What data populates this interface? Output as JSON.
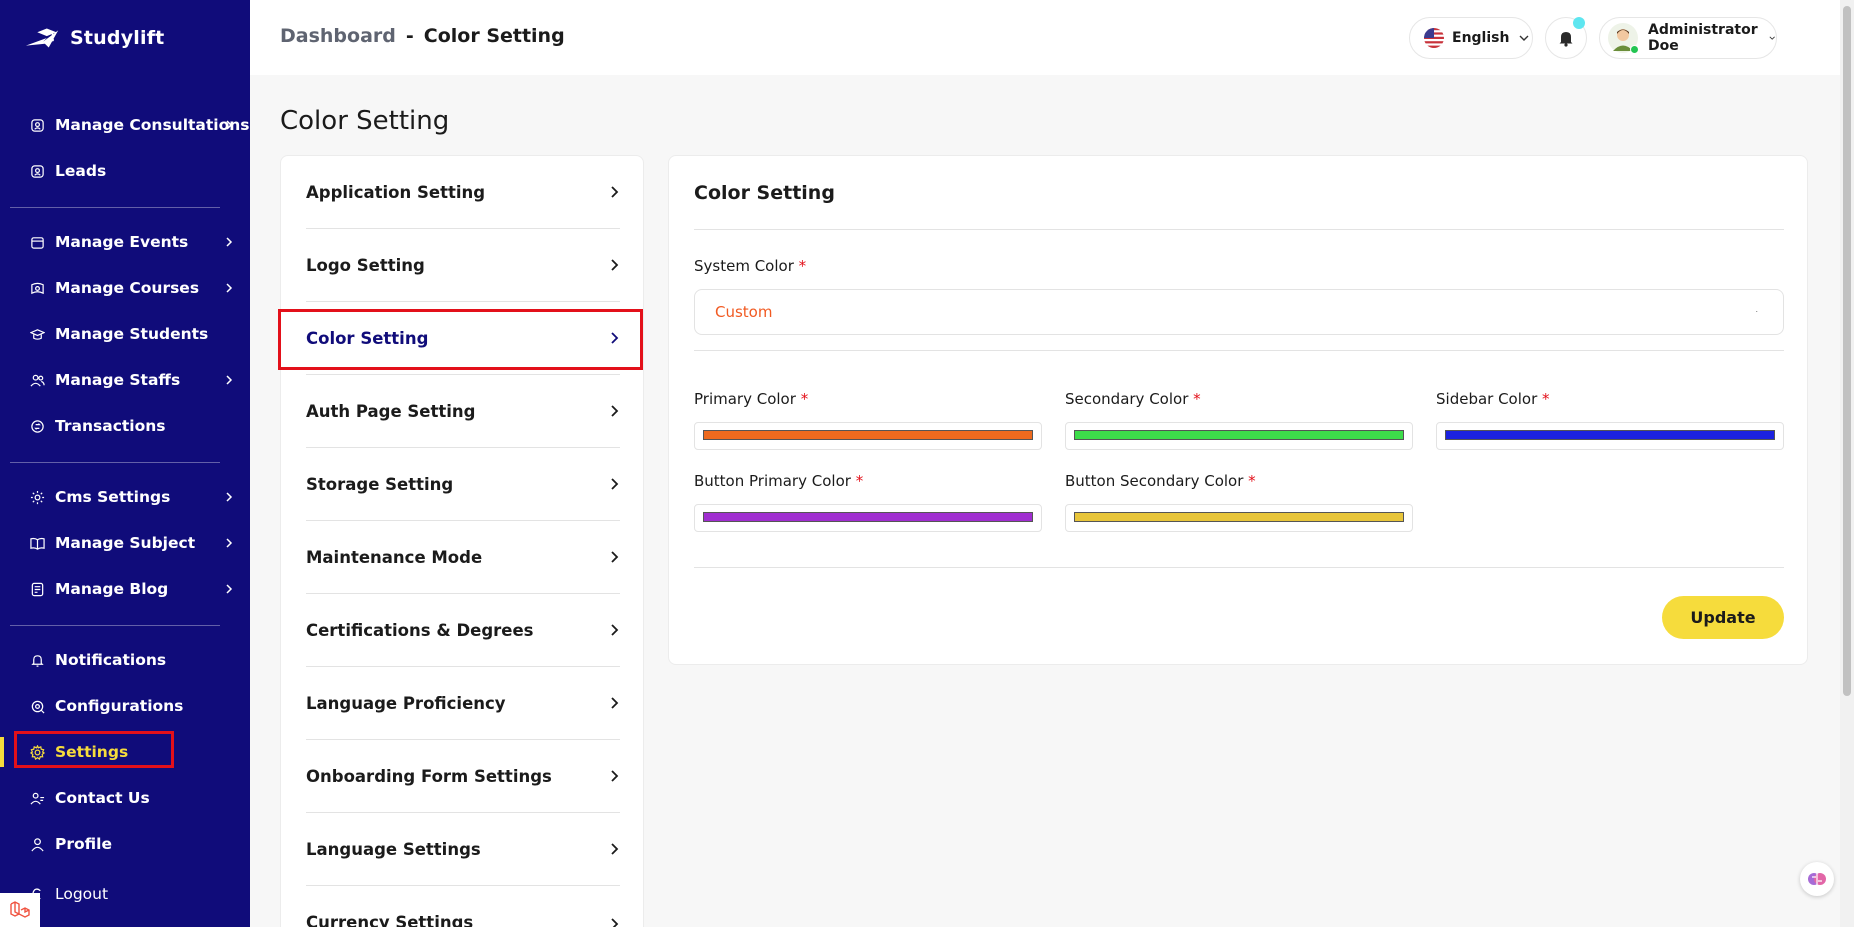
{
  "app": {
    "name": "Studylift"
  },
  "sidebar": {
    "items": [
      {
        "label": "Manage Consultations",
        "icon": "consultation-icon",
        "has_children": true
      },
      {
        "label": "Leads",
        "icon": "leads-icon",
        "has_children": false
      },
      {
        "label": "Manage Events",
        "icon": "calendar-icon",
        "has_children": true
      },
      {
        "label": "Manage Courses",
        "icon": "courses-icon",
        "has_children": true
      },
      {
        "label": "Manage Students",
        "icon": "students-icon",
        "has_children": false
      },
      {
        "label": "Manage Staffs",
        "icon": "staff-icon",
        "has_children": true
      },
      {
        "label": "Transactions",
        "icon": "transactions-icon",
        "has_children": false
      },
      {
        "label": "Cms Settings",
        "icon": "cms-icon",
        "has_children": true
      },
      {
        "label": "Manage Subject",
        "icon": "book-icon",
        "has_children": true
      },
      {
        "label": "Manage Blog",
        "icon": "blog-icon",
        "has_children": true
      },
      {
        "label": "Notifications",
        "icon": "bell-icon",
        "has_children": false
      },
      {
        "label": "Configurations",
        "icon": "configuration-icon",
        "has_children": false
      },
      {
        "label": "Settings",
        "icon": "gear-icon",
        "has_children": false,
        "active": true
      },
      {
        "label": "Contact Us",
        "icon": "contact-icon",
        "has_children": false
      },
      {
        "label": "Profile",
        "icon": "user-icon",
        "has_children": false
      },
      {
        "label": "Logout",
        "icon": "logout-icon",
        "has_children": false
      }
    ]
  },
  "header": {
    "breadcrumb": {
      "root": "Dashboard",
      "separator": "-",
      "current": "Color Setting"
    },
    "language": "English",
    "user_name": "Administrator Doe"
  },
  "page": {
    "title": "Color Setting"
  },
  "settings_menu": {
    "items": [
      {
        "label": "Application Setting"
      },
      {
        "label": "Logo Setting"
      },
      {
        "label": "Color Setting",
        "active": true
      },
      {
        "label": "Auth Page Setting"
      },
      {
        "label": "Storage Setting"
      },
      {
        "label": "Maintenance Mode"
      },
      {
        "label": "Certifications & Degrees"
      },
      {
        "label": "Language Proficiency"
      },
      {
        "label": "Onboarding Form Settings"
      },
      {
        "label": "Language Settings"
      },
      {
        "label": "Currency Settings"
      }
    ]
  },
  "color_form": {
    "title": "Color Setting",
    "system_color": {
      "label": "System Color",
      "required": "*",
      "value": "Custom"
    },
    "colors": [
      {
        "label": "Primary Color",
        "required": "*",
        "value": "#ee6a1e"
      },
      {
        "label": "Secondary Color",
        "required": "*",
        "value": "#3ddd4a"
      },
      {
        "label": "Sidebar Color",
        "required": "*",
        "value": "#1b22e0"
      },
      {
        "label": "Button Primary Color",
        "required": "*",
        "value": "#a02ed0"
      },
      {
        "label": "Button Secondary Color",
        "required": "*",
        "value": "#e8c53a"
      }
    ],
    "update_label": "Update"
  },
  "colors": {
    "sidebar_bg": "#100c7a",
    "accent_yellow": "#f6dc3c",
    "highlight_red": "#e3101a",
    "select_text": "#f15a22"
  }
}
